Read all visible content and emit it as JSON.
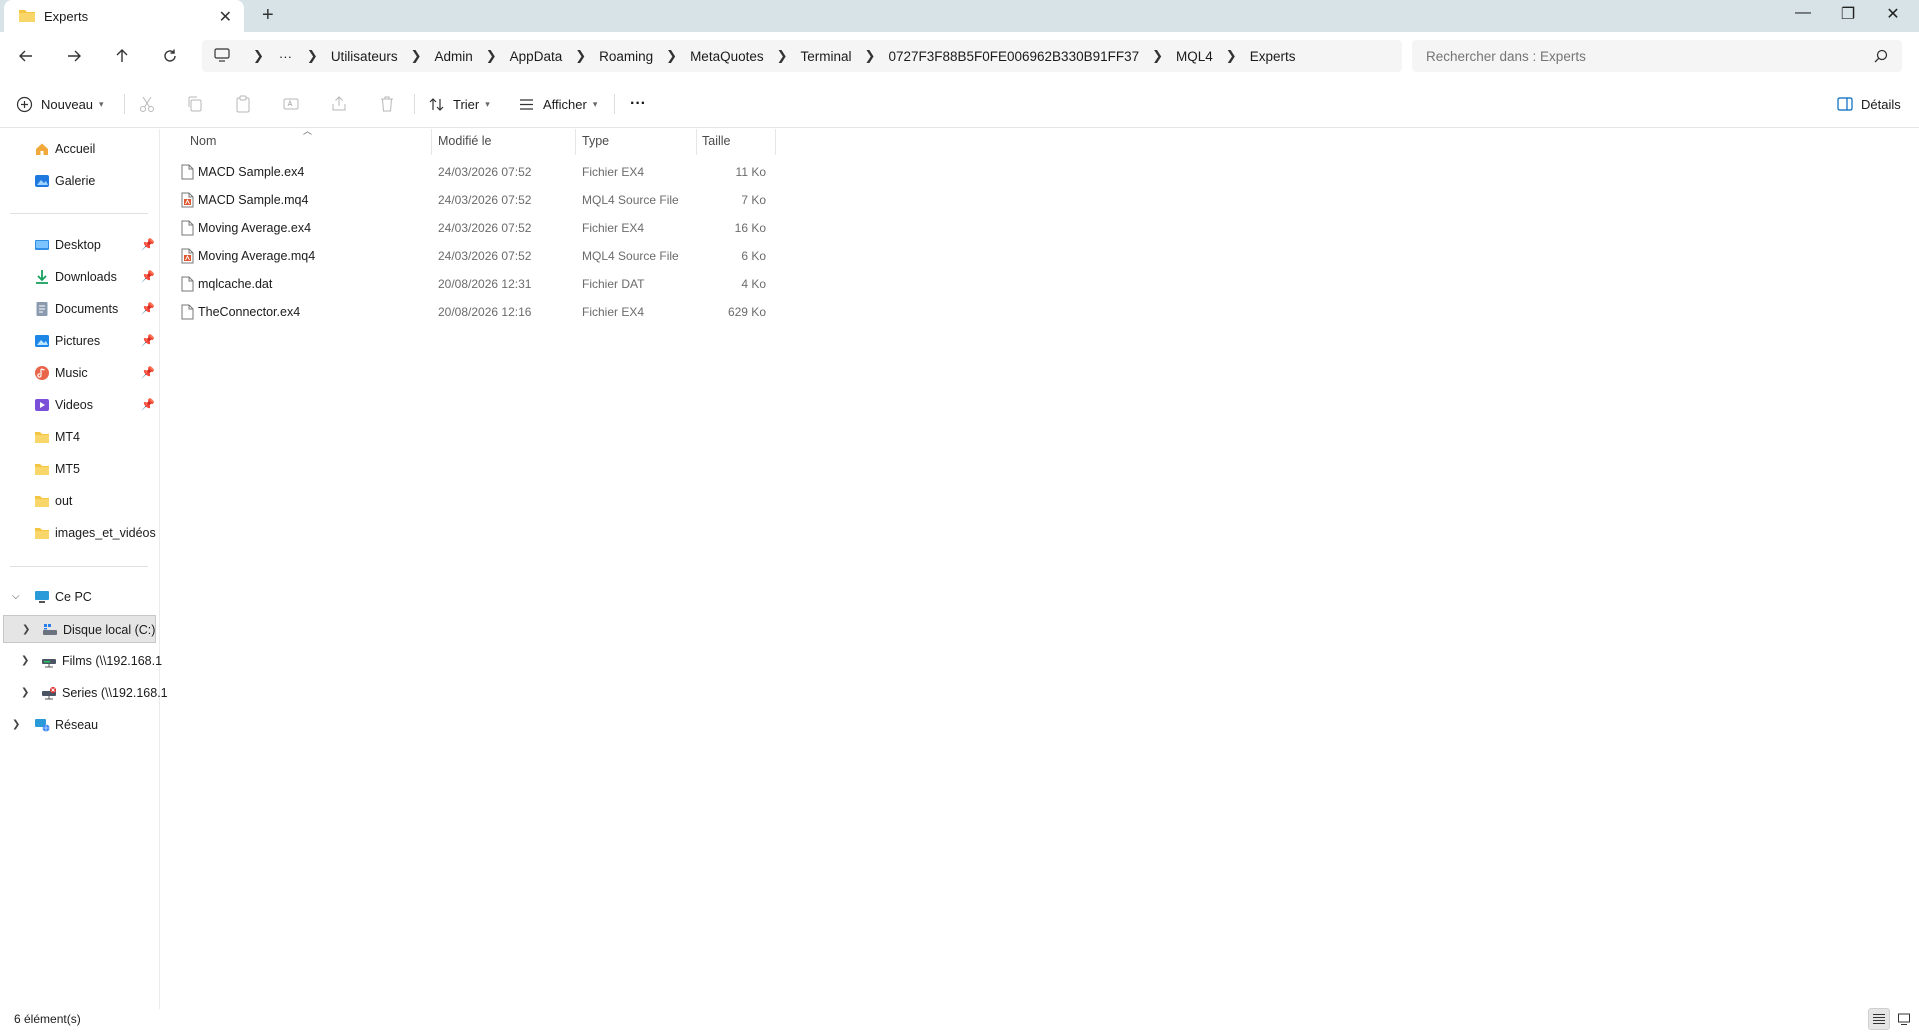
{
  "window": {
    "tab_title": "Experts",
    "new_tab": "+",
    "close_tab": "✕",
    "minimize": "—",
    "maximize": "❐",
    "close": "✕"
  },
  "address": {
    "overflow": "···",
    "breadcrumbs": [
      "Utilisateurs",
      "Admin",
      "AppData",
      "Roaming",
      "MetaQuotes",
      "Terminal",
      "0727F3F88B5F0FE006962B330B91FF37",
      "MQL4",
      "Experts"
    ],
    "search_placeholder": "Rechercher dans : Experts"
  },
  "toolbar": {
    "new_label": "Nouveau",
    "sort_label": "Trier",
    "view_label": "Afficher",
    "more_label": "···",
    "details_label": "Détails"
  },
  "sidebar": {
    "quick": [
      {
        "label": "Accueil",
        "icon": "home-icon"
      },
      {
        "label": "Galerie",
        "icon": "gallery-icon"
      }
    ],
    "pinned": [
      {
        "label": "Desktop",
        "icon": "desktop-icon",
        "pinned": true
      },
      {
        "label": "Downloads",
        "icon": "downloads-icon",
        "pinned": true
      },
      {
        "label": "Documents",
        "icon": "documents-icon",
        "pinned": true
      },
      {
        "label": "Pictures",
        "icon": "pictures-icon",
        "pinned": true
      },
      {
        "label": "Music",
        "icon": "music-icon",
        "pinned": true
      },
      {
        "label": "Videos",
        "icon": "videos-icon",
        "pinned": true
      },
      {
        "label": "MT4",
        "icon": "folder-icon",
        "pinned": false
      },
      {
        "label": "MT5",
        "icon": "folder-icon",
        "pinned": false
      },
      {
        "label": "out",
        "icon": "folder-icon",
        "pinned": false
      },
      {
        "label": "images_et_vidéos",
        "icon": "folder-icon",
        "pinned": false
      }
    ],
    "this_pc": "Ce PC",
    "drives": [
      {
        "label": "Disque local (C:)",
        "icon": "drive-icon"
      },
      {
        "label": "Films (\\\\192.168.1",
        "icon": "network-drive-icon"
      },
      {
        "label": "Series (\\\\192.168.1",
        "icon": "network-drive-disconnected-icon"
      }
    ],
    "network": "Réseau"
  },
  "list": {
    "columns": {
      "name": "Nom",
      "modified": "Modifié le",
      "type": "Type",
      "size": "Taille"
    },
    "files": [
      {
        "name": "MACD Sample.ex4",
        "modified": "24/03/2026 07:52",
        "type": "Fichier EX4",
        "size": "11 Ko",
        "icon": "file-icon"
      },
      {
        "name": "MACD Sample.mq4",
        "modified": "24/03/2026 07:52",
        "type": "MQL4 Source File",
        "size": "7 Ko",
        "icon": "mq4-file-icon"
      },
      {
        "name": "Moving Average.ex4",
        "modified": "24/03/2026 07:52",
        "type": "Fichier EX4",
        "size": "16 Ko",
        "icon": "file-icon"
      },
      {
        "name": "Moving Average.mq4",
        "modified": "24/03/2026 07:52",
        "type": "MQL4 Source File",
        "size": "6 Ko",
        "icon": "mq4-file-icon"
      },
      {
        "name": "mqlcache.dat",
        "modified": "20/08/2026 12:31",
        "type": "Fichier DAT",
        "size": "4 Ko",
        "icon": "file-icon"
      },
      {
        "name": "TheConnector.ex4",
        "modified": "20/08/2026 12:16",
        "type": "Fichier EX4",
        "size": "629 Ko",
        "icon": "file-icon"
      }
    ]
  },
  "status": {
    "count": "6 élément(s)"
  },
  "colors": {
    "folder": "#f4c543",
    "accent": "#0067c0",
    "titlebar": "#d7e3e6"
  }
}
